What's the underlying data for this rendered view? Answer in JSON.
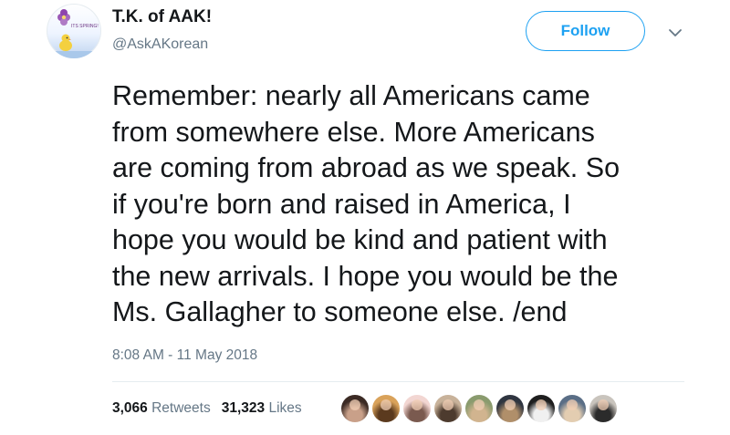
{
  "user": {
    "display_name": "T.K. of AAK!",
    "handle": "@AskAKorean",
    "avatar_caption": "ITS SPRING!"
  },
  "follow_label": "Follow",
  "tweet_text": "Remember: nearly all Americans came\nfrom somewhere else. More Americans\nare coming from abroad as we speak. So\nif you're born and raised in America, I\nhope you would be kind and patient with\nthe new arrivals. I hope you would be the\nMs. Gallagher to someone else. /end",
  "timestamp": "8:08 AM - 11 May 2018",
  "stats": {
    "retweets_count": "3,066",
    "retweets_label": "Retweets",
    "likes_count": "31,323",
    "likes_label": "Likes"
  },
  "liker_avatars": [
    {
      "name": "liker-avatar-1",
      "bg": "#3b2a24",
      "accent": "#c9a089"
    },
    {
      "name": "liker-avatar-2",
      "bg": "#d9a25a",
      "accent": "#5b3a1e"
    },
    {
      "name": "liker-avatar-3",
      "bg": "#f2d6d2",
      "accent": "#7a5a4f"
    },
    {
      "name": "liker-avatar-4",
      "bg": "#c8b29a",
      "accent": "#4d3b2e"
    },
    {
      "name": "liker-avatar-5",
      "bg": "#8a9b6e",
      "accent": "#d1b48f"
    },
    {
      "name": "liker-avatar-6",
      "bg": "#2f3540",
      "accent": "#b08f6a"
    },
    {
      "name": "liker-avatar-7",
      "bg": "#1e1e1e",
      "accent": "#f0f0f0"
    },
    {
      "name": "liker-avatar-8",
      "bg": "#5a6e86",
      "accent": "#e3cdb1"
    },
    {
      "name": "liker-avatar-9",
      "bg": "#c9c4bd",
      "accent": "#2b2b2b"
    }
  ],
  "colors": {
    "accent": "#1da1f2",
    "text": "#14171a",
    "secondary_text": "#657786",
    "divider": "#e6ecf0"
  }
}
